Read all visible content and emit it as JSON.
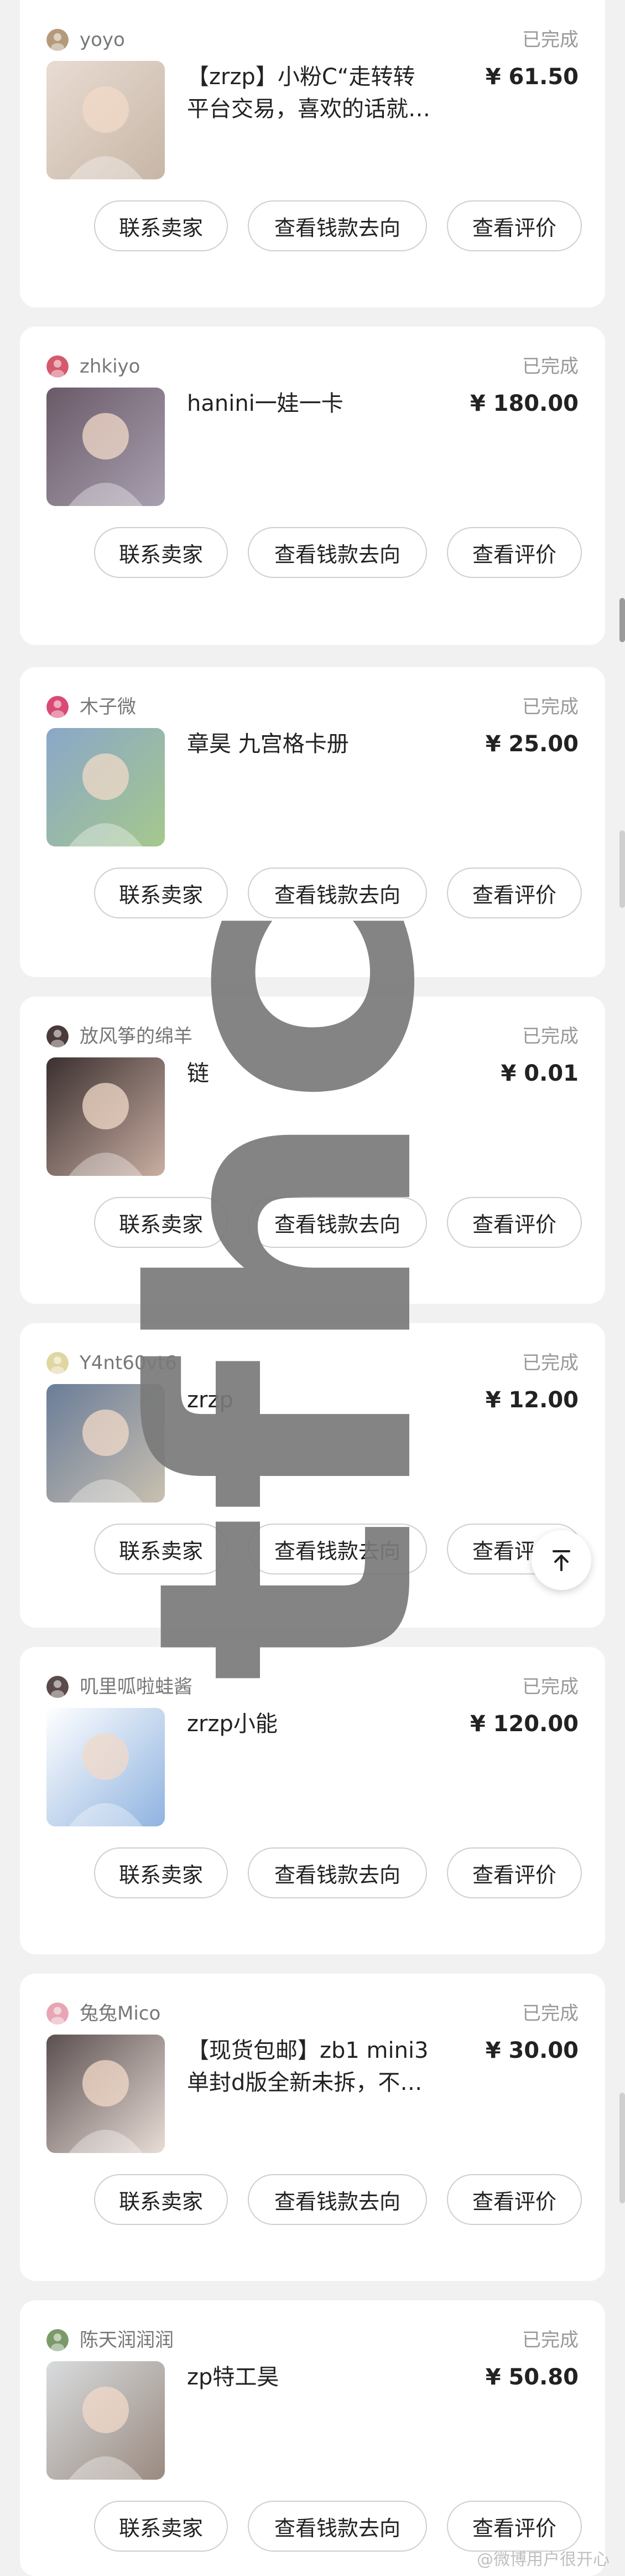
{
  "orders": [
    {
      "seller": "yoyo",
      "status": "已完成",
      "title": "【zrzp】小粉C“走转转平台交易，喜欢的话就…",
      "price": "¥ 61.50",
      "avatar_color": "#b39a7a",
      "thumb_colors": [
        "#e9dcd3",
        "#c7b6a6"
      ]
    },
    {
      "seller": "zhkiyo",
      "status": "已完成",
      "title": "hanini一娃一卡",
      "price": "¥ 180.00",
      "avatar_color": "#d55a6c",
      "thumb_colors": [
        "#6a5a68",
        "#a9a0b0"
      ]
    },
    {
      "seller": "木子微",
      "status": "已完成",
      "title": "章昊 九宫格卡册",
      "price": "¥ 25.00",
      "avatar_color": "#d94a75",
      "thumb_colors": [
        "#8aa7c9",
        "#a5c88c"
      ]
    },
    {
      "seller": "放风筝的绵羊",
      "status": "已完成",
      "title": "链",
      "price": "¥ 0.01",
      "avatar_color": "#4a3a3a",
      "thumb_colors": [
        "#3b3030",
        "#c9aea2"
      ]
    },
    {
      "seller": "Y4nt60vt6",
      "status": "已完成",
      "title": "zrzp",
      "price": "¥ 12.00",
      "avatar_color": "#e0d6a0",
      "thumb_colors": [
        "#6a7d99",
        "#c9c0b0"
      ]
    },
    {
      "seller": "叽里呱啦蛙酱",
      "status": "已完成",
      "title": "zrzp小能",
      "price": "¥ 120.00",
      "avatar_color": "#5a4a4a",
      "thumb_colors": [
        "#ffffff",
        "#8fb3e0"
      ]
    },
    {
      "seller": "兔兔Mico",
      "status": "已完成",
      "title": "【现货包邮】zb1 mini3单封d版全新未拆，不…",
      "price": "¥ 30.00",
      "avatar_color": "#e7a6b3",
      "thumb_colors": [
        "#5b5050",
        "#e8ddd6"
      ]
    },
    {
      "seller": "陈天润润润",
      "status": "已完成",
      "title": "zp特工昊",
      "price": "¥ 50.80",
      "avatar_color": "#7a9a6a",
      "thumb_colors": [
        "#d8dcde",
        "#9a8a80"
      ]
    }
  ],
  "buttons": {
    "contact": "联系卖家",
    "money": "查看钱款去向",
    "review": "查看评价"
  },
  "watermark": "tfhc",
  "footer_watermark": "@微博用户很开心"
}
